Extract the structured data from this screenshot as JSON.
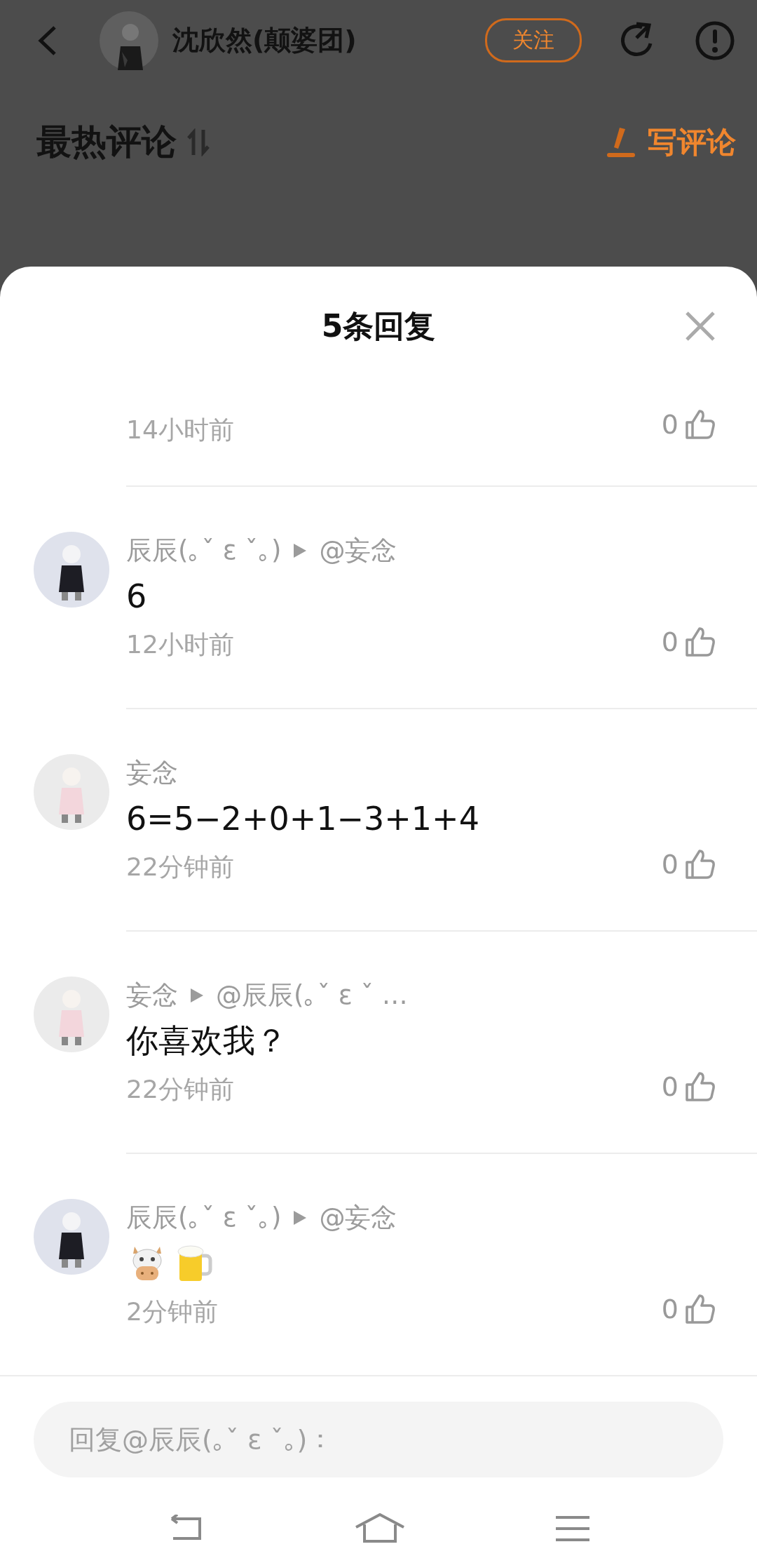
{
  "header": {
    "author": "沈欣然(颠婆团)",
    "follow_label": "关注"
  },
  "section": {
    "title": "最热评论",
    "write_label": "写评论"
  },
  "sheet": {
    "title": "5条回复",
    "replies": [
      {
        "time": "14小时前",
        "likes": "0"
      },
      {
        "avatar": {
          "kind": "dark"
        },
        "author": "辰辰(｡ˇ ε ˇ｡)",
        "reply_to": "@妄念",
        "content": "6",
        "time": "12小时前",
        "likes": "0"
      },
      {
        "avatar": {
          "kind": "light"
        },
        "author": "妄念",
        "content": "6=5−2+0+1−3+1+4",
        "time": "22分钟前",
        "likes": "0"
      },
      {
        "avatar": {
          "kind": "light"
        },
        "author": "妄念",
        "reply_to": "@辰辰(｡ˇ ε ˇ …",
        "content": "你喜欢我？",
        "time": "22分钟前",
        "likes": "0"
      },
      {
        "avatar": {
          "kind": "dark"
        },
        "author": "辰辰(｡ˇ ε ˇ｡)",
        "reply_to": "@妄念",
        "emoji": [
          {
            "kind": "cow"
          },
          {
            "kind": "beer"
          }
        ],
        "time": "2分钟前",
        "likes": "0"
      }
    ]
  },
  "reply_input": {
    "placeholder": "回复@辰辰(｡ˇ ε ˇ｡)："
  }
}
